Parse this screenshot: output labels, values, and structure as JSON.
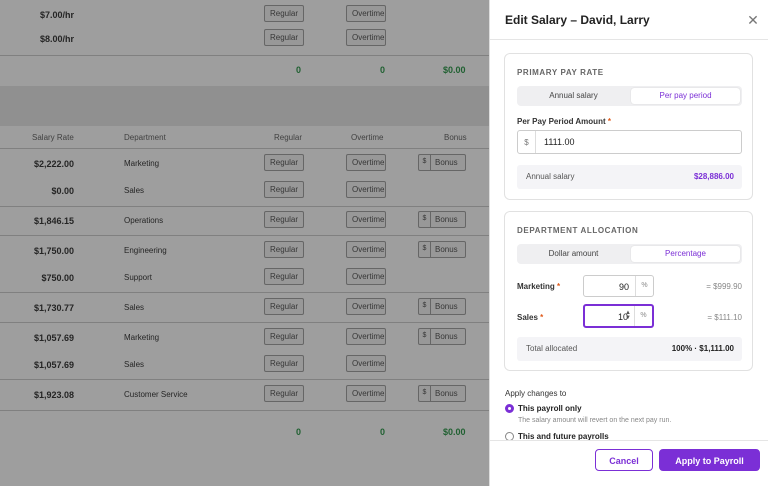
{
  "background": {
    "columns": {
      "salary_rate": "Salary Rate",
      "department": "Department",
      "regular": "Regular",
      "overtime": "Overtime",
      "bonus": "Bonus"
    },
    "pill_regular": "Regular",
    "pill_overtime": "Overtime",
    "bonus_placeholder": "Bonus",
    "currency": "$",
    "top_rows": [
      {
        "rate": "$7.00/hr"
      },
      {
        "rate": "$8.00/hr"
      }
    ],
    "top_totals": {
      "regular": "0",
      "overtime": "0",
      "bonus": "$0.00"
    },
    "rows": [
      {
        "rate": "$2,222.00",
        "department": "Marketing"
      },
      {
        "rate": "$0.00",
        "department": "Sales"
      },
      {
        "rate": "$1,846.15",
        "department": "Operations"
      },
      {
        "rate": "$1,750.00",
        "department": "Engineering"
      },
      {
        "rate": "$750.00",
        "department": "Support"
      },
      {
        "rate": "$1,730.77",
        "department": "Sales"
      },
      {
        "rate": "$1,057.69",
        "department": "Marketing"
      },
      {
        "rate": "$1,057.69",
        "department": "Sales"
      },
      {
        "rate": "$1,923.08",
        "department": "Customer Service"
      }
    ],
    "bottom_totals": {
      "regular": "0",
      "overtime": "0",
      "bonus": "$0.00"
    }
  },
  "modal": {
    "title": "Edit Salary – David, Larry",
    "close_icon": "close-icon",
    "primary": {
      "title": "PRIMARY PAY RATE",
      "options": [
        "Annual salary",
        "Per pay period"
      ],
      "selected": "Per pay period",
      "field_label": "Per Pay Period Amount",
      "required_mark": "*",
      "currency": "$",
      "amount": "1111.00",
      "annual_label": "Annual salary",
      "annual_value": "$28,886.00"
    },
    "allocation": {
      "title": "DEPARTMENT ALLOCATION",
      "options": [
        "Dollar amount",
        "Percentage"
      ],
      "selected": "Percentage",
      "unit": "%",
      "rows": [
        {
          "department": "Marketing",
          "required_mark": "*",
          "percent": "90",
          "amount": "= $999.90"
        },
        {
          "department": "Sales",
          "required_mark": "*",
          "percent": "10",
          "amount": "= $111.10"
        }
      ],
      "total_label": "Total allocated",
      "total_value": "100% · $1,111.00"
    },
    "apply": {
      "title": "Apply changes to",
      "option1": "This payroll only",
      "option1_hint": "The salary amount will revert on the next pay run.",
      "option2": "This and future payrolls"
    },
    "buttons": {
      "cancel": "Cancel",
      "apply": "Apply to Payroll"
    }
  },
  "colors": {
    "accent": "#7b2fd6",
    "positive": "#1a8f3a",
    "required": "#e05a1a"
  }
}
